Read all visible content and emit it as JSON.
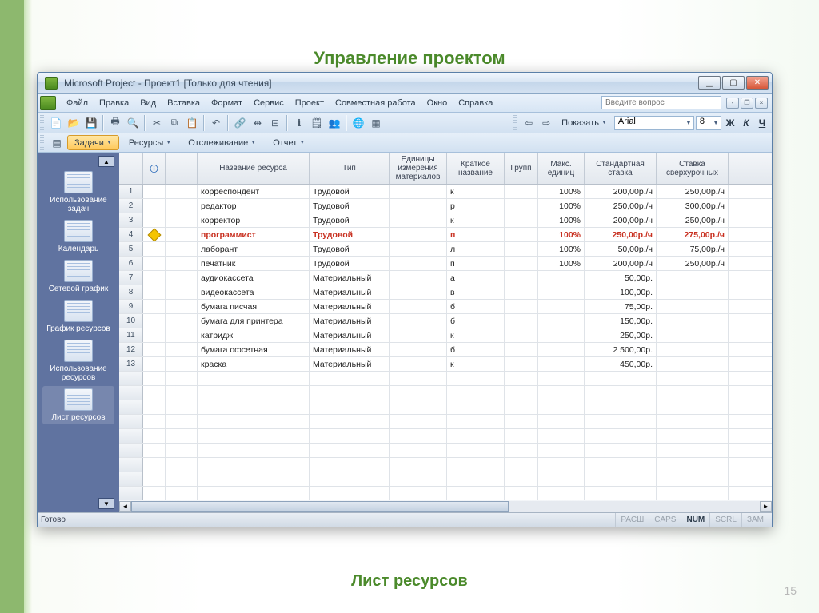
{
  "slide": {
    "title": "Управление проектом",
    "footer": "Лист ресурсов",
    "page_num": "15"
  },
  "window": {
    "title": "Microsoft Project - Проект1 [Только для чтения]"
  },
  "menu": {
    "items": [
      "Файл",
      "Правка",
      "Вид",
      "Вставка",
      "Формат",
      "Сервис",
      "Проект",
      "Совместная работа",
      "Окно",
      "Справка"
    ],
    "help_placeholder": "Введите вопрос"
  },
  "toolbar2": {
    "show_label": "Показать",
    "font_name": "Arial",
    "font_size": "8",
    "bold": "Ж",
    "italic": "К",
    "underline": "Ч"
  },
  "viewbar": {
    "tasks": "Задачи",
    "resources": "Ресурсы",
    "tracking": "Отслеживание",
    "report": "Отчет"
  },
  "sidepanel": {
    "items": [
      {
        "label": "Использование задач"
      },
      {
        "label": "Календарь"
      },
      {
        "label": "Сетевой график"
      },
      {
        "label": "График ресурсов"
      },
      {
        "label": "Использование ресурсов"
      },
      {
        "label": "Лист ресурсов"
      }
    ]
  },
  "grid": {
    "headers": {
      "indicator": "",
      "name": "Название ресурса",
      "type": "Тип",
      "unit": "Единицы измерения материалов",
      "short": "Краткое название",
      "group": "Групп",
      "max": "Макс. единиц",
      "rate": "Стандартная ставка",
      "over": "Ставка сверхурочных"
    },
    "rows": [
      {
        "n": "1",
        "ind": "",
        "name": "корреспондент",
        "type": "Трудовой",
        "unit": "",
        "short": "к",
        "group": "",
        "max": "100%",
        "rate": "200,00р./ч",
        "over": "250,00р./ч",
        "warn": false
      },
      {
        "n": "2",
        "ind": "",
        "name": "редактор",
        "type": "Трудовой",
        "unit": "",
        "short": "р",
        "group": "",
        "max": "100%",
        "rate": "250,00р./ч",
        "over": "300,00р./ч",
        "warn": false
      },
      {
        "n": "3",
        "ind": "",
        "name": "корректор",
        "type": "Трудовой",
        "unit": "",
        "short": "к",
        "group": "",
        "max": "100%",
        "rate": "200,00р./ч",
        "over": "250,00р./ч",
        "warn": false
      },
      {
        "n": "4",
        "ind": "!",
        "name": "программист",
        "type": "Трудовой",
        "unit": "",
        "short": "п",
        "group": "",
        "max": "100%",
        "rate": "250,00р./ч",
        "over": "275,00р./ч",
        "warn": true
      },
      {
        "n": "5",
        "ind": "",
        "name": "лаборант",
        "type": "Трудовой",
        "unit": "",
        "short": "л",
        "group": "",
        "max": "100%",
        "rate": "50,00р./ч",
        "over": "75,00р./ч",
        "warn": false
      },
      {
        "n": "6",
        "ind": "",
        "name": "печатник",
        "type": "Трудовой",
        "unit": "",
        "short": "п",
        "group": "",
        "max": "100%",
        "rate": "200,00р./ч",
        "over": "250,00р./ч",
        "warn": false
      },
      {
        "n": "7",
        "ind": "",
        "name": "аудиокассета",
        "type": "Материальный",
        "unit": "",
        "short": "а",
        "group": "",
        "max": "",
        "rate": "50,00р.",
        "over": "",
        "warn": false
      },
      {
        "n": "8",
        "ind": "",
        "name": "видеокассета",
        "type": "Материальный",
        "unit": "",
        "short": "в",
        "group": "",
        "max": "",
        "rate": "100,00р.",
        "over": "",
        "warn": false
      },
      {
        "n": "9",
        "ind": "",
        "name": "бумага писчая",
        "type": "Материальный",
        "unit": "",
        "short": "б",
        "group": "",
        "max": "",
        "rate": "75,00р.",
        "over": "",
        "warn": false
      },
      {
        "n": "10",
        "ind": "",
        "name": "бумага для принтера",
        "type": "Материальный",
        "unit": "",
        "short": "б",
        "group": "",
        "max": "",
        "rate": "150,00р.",
        "over": "",
        "warn": false
      },
      {
        "n": "11",
        "ind": "",
        "name": "катридж",
        "type": "Материальный",
        "unit": "",
        "short": "к",
        "group": "",
        "max": "",
        "rate": "250,00р.",
        "over": "",
        "warn": false
      },
      {
        "n": "12",
        "ind": "",
        "name": "бумага офсетная",
        "type": "Материальный",
        "unit": "",
        "short": "б",
        "group": "",
        "max": "",
        "rate": "2 500,00р.",
        "over": "",
        "warn": false
      },
      {
        "n": "13",
        "ind": "",
        "name": "краска",
        "type": "Материальный",
        "unit": "",
        "short": "к",
        "group": "",
        "max": "",
        "rate": "450,00р.",
        "over": "",
        "warn": false
      }
    ]
  },
  "status": {
    "ready": "Готово",
    "caps": "CAPS",
    "num": "NUM",
    "scrl": "SCRL",
    "ext": "РАСШ",
    "ovr": "ЗАМ"
  }
}
